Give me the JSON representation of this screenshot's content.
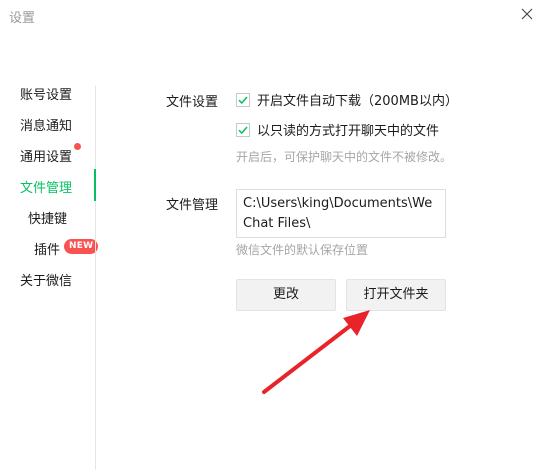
{
  "window": {
    "title": "设置"
  },
  "sidebar": {
    "items": [
      {
        "label": "账号设置"
      },
      {
        "label": "消息通知"
      },
      {
        "label": "通用设置"
      },
      {
        "label": "文件管理"
      },
      {
        "label": "快捷键"
      },
      {
        "label": "插件",
        "badge": "NEW"
      },
      {
        "label": "关于微信"
      }
    ],
    "active_item": "文件管理"
  },
  "file_settings": {
    "label": "文件设置",
    "options": [
      {
        "label": "开启文件自动下载（200MB以内）",
        "checked": true
      },
      {
        "label": "以只读的方式打开聊天中的文件",
        "checked": true
      }
    ],
    "hint": "开启后，可保护聊天中的文件不被修改。"
  },
  "file_management": {
    "label": "文件管理",
    "path": "C:\\Users\\king\\Documents\\WeChat Files\\",
    "hint": "微信文件的默认保存位置",
    "change_button": "更改",
    "open_folder_button": "打开文件夹"
  },
  "colors": {
    "accent": "#07c160",
    "badge": "#fa5151",
    "annotation_arrow": "#e8242a"
  }
}
